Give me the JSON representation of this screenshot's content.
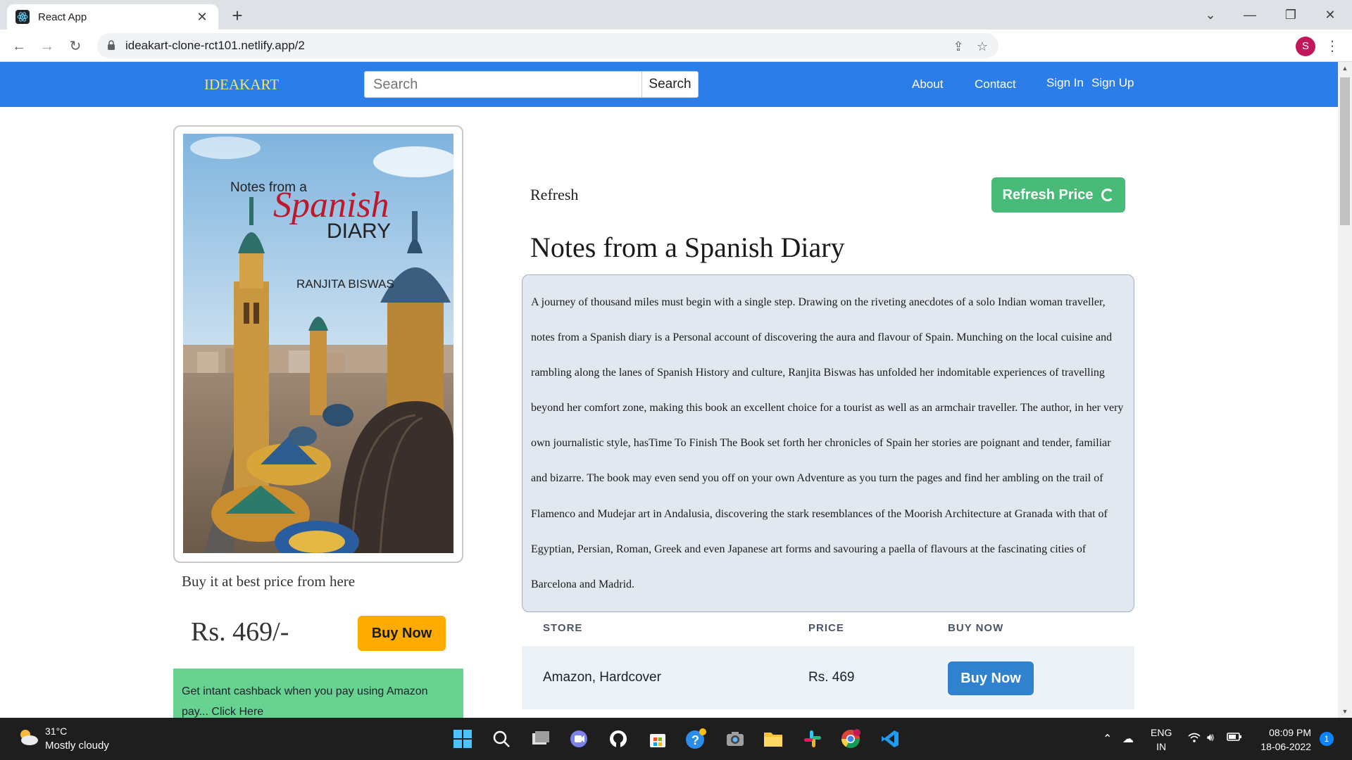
{
  "browser": {
    "tab_title": "React App",
    "url": "ideakart-clone-rct101.netlify.app/2",
    "profile_initial": "S"
  },
  "navbar": {
    "brand": "IDEAKART",
    "search_placeholder": "Search",
    "search_button": "Search",
    "links": {
      "about": "About",
      "contact": "Contact",
      "sign_in": "Sign In",
      "sign_up": "Sign Up"
    },
    "bg_color": "#2b7de9",
    "brand_color": "#f5e663"
  },
  "product": {
    "cover": {
      "title_line1": "Notes from a",
      "title_script": "Spanish",
      "title_line2": "DIARY",
      "author": "RANJITA BISWAS"
    },
    "buy_text": "Buy it at best price from here",
    "price": "Rs. 469/-",
    "buy_button": "Buy Now",
    "cashback": "Get intant cashback when you pay using Amazon pay... Click Here",
    "refresh_label": "Refresh",
    "refresh_button": "Refresh Price",
    "title": "Notes from a Spanish Diary",
    "description": "A journey of thousand miles must begin with a single step. Drawing on the riveting anecdotes of a solo Indian woman traveller, notes from a Spanish diary is a Personal account of discovering the aura and flavour of Spain. Munching on the local cuisine and rambling along the lanes of Spanish History and culture, Ranjita Biswas has unfolded her indomitable experiences of travelling beyond her comfort zone, making this book an excellent choice for a tourist as well as an armchair traveller. The author, in her very own journalistic style, hasTime To Finish The Book set forth her chronicles of Spain her stories are poignant and tender, familiar and bizarre. The book may even send you off on your own Adventure as you turn the pages and find her ambling on the trail of Flamenco and Mudejar art in Andalusia, discovering the stark resemblances of the Moorish Architecture at Granada with that of Egyptian, Persian, Roman, Greek and even Japanese art forms and savouring a paella of flavours at the fascinating cities of Barcelona and Madrid."
  },
  "store_table": {
    "headers": [
      "STORE",
      "PRICE",
      "BUY NOW"
    ],
    "rows": [
      {
        "store": "Amazon, Hardcover",
        "price": "Rs. 469",
        "action": "Buy Now"
      }
    ]
  },
  "taskbar": {
    "temperature": "31°C",
    "weather": "Mostly cloudy",
    "lang1": "ENG",
    "lang2": "IN",
    "time": "08:09 PM",
    "date": "18-06-2022",
    "notifications": "1"
  }
}
